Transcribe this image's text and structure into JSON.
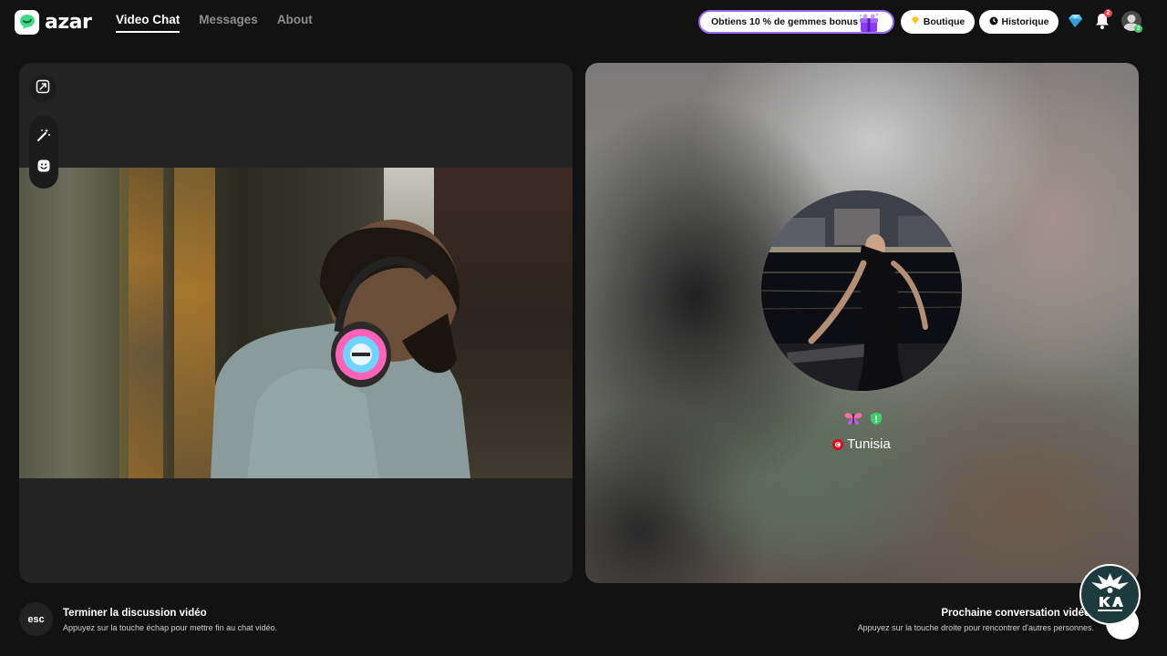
{
  "brand": {
    "name": "azar",
    "logo_icon": "azar-chat-bubble-icon"
  },
  "nav": [
    {
      "label": "Video Chat",
      "active": true
    },
    {
      "label": "Messages",
      "active": false
    },
    {
      "label": "About",
      "active": false
    }
  ],
  "header": {
    "promo_text": "Obtiens 10 % de gemmes bonus !",
    "shop_label": "Boutique",
    "history_label": "Historique",
    "notification_count": "2",
    "profile_badge": "3"
  },
  "partner": {
    "country": "Tunisia",
    "flag_color": "#e70013"
  },
  "footer": {
    "esc_key": "esc",
    "end_title": "Terminer la discussion vidéo",
    "end_desc": "Appuyez sur la touche échap pour mettre fin au chat vidéo.",
    "next_title": "Prochaine conversation vidéo",
    "next_desc": "Appuyez sur la touche droite pour rencontrer d'autres personnes."
  },
  "colors": {
    "background": "#121212",
    "panel": "#232323",
    "promo_border": "#9b6cf0",
    "notification_badge": "#ff3b48",
    "online_badge": "#3ecf6d",
    "brand_green": "#3ddc84"
  }
}
